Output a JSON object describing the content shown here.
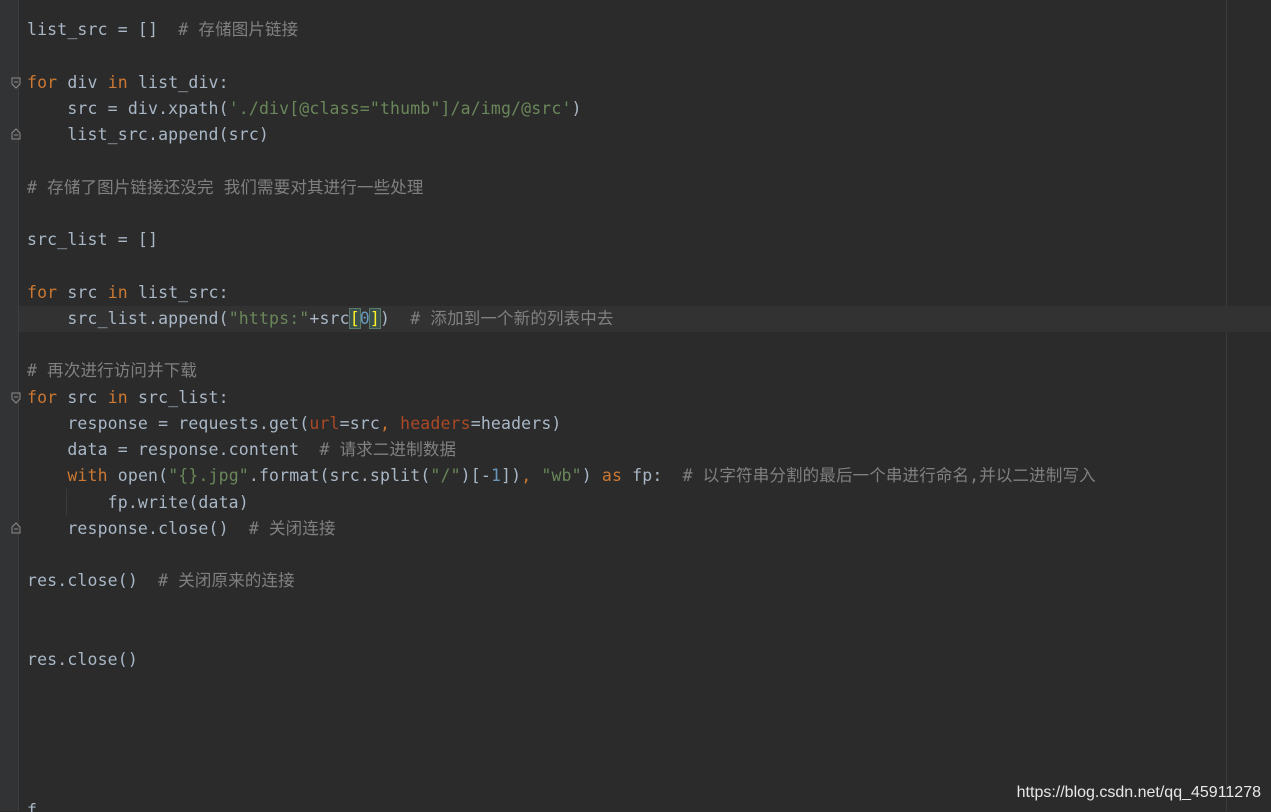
{
  "editor": {
    "lines": [
      {
        "id": "l1",
        "tokens": [
          {
            "t": "list_src = []  ",
            "c": ""
          },
          {
            "t": "# 存储图片链接",
            "c": "cmt"
          }
        ]
      },
      {
        "id": "l2",
        "tokens": [
          {
            "t": "for",
            "c": "kw"
          },
          {
            "t": " div ",
            "c": ""
          },
          {
            "t": "in",
            "c": "kw"
          },
          {
            "t": " list_div:",
            "c": ""
          }
        ]
      },
      {
        "id": "l3",
        "tokens": [
          {
            "t": "    src = div.xpath(",
            "c": ""
          },
          {
            "t": "'./div[@class=\"thumb\"]/a/img/@src'",
            "c": "str"
          },
          {
            "t": ")",
            "c": ""
          }
        ]
      },
      {
        "id": "l4",
        "tokens": [
          {
            "t": "    list_src.append(src)",
            "c": ""
          }
        ]
      },
      {
        "id": "l5",
        "tokens": [
          {
            "t": "# 存储了图片链接还没完 我们需要对其进行一些处理",
            "c": "cmt"
          }
        ]
      },
      {
        "id": "l6",
        "tokens": [
          {
            "t": "src_list = []",
            "c": ""
          }
        ]
      },
      {
        "id": "l7",
        "tokens": [
          {
            "t": "for",
            "c": "kw"
          },
          {
            "t": " src ",
            "c": ""
          },
          {
            "t": "in",
            "c": "kw"
          },
          {
            "t": " list_src:",
            "c": ""
          }
        ]
      },
      {
        "id": "l8",
        "tokens": [
          {
            "t": "    src_list.append(",
            "c": ""
          },
          {
            "t": "\"https:\"",
            "c": "str"
          },
          {
            "t": "+src",
            "c": ""
          },
          {
            "t": "[",
            "c": "brace-hl brace-y"
          },
          {
            "t": "0",
            "c": "num"
          },
          {
            "t": "]",
            "c": "brace-hl brace-y"
          },
          {
            "t": ")  ",
            "c": ""
          },
          {
            "t": "# 添加到一个新的列表中去",
            "c": "cmt"
          }
        ]
      },
      {
        "id": "l9",
        "tokens": [
          {
            "t": "# 再次进行访问并下载",
            "c": "cmt"
          }
        ]
      },
      {
        "id": "l10",
        "tokens": [
          {
            "t": "for",
            "c": "kw"
          },
          {
            "t": " src ",
            "c": ""
          },
          {
            "t": "in",
            "c": "kw"
          },
          {
            "t": " src_list:",
            "c": ""
          }
        ]
      },
      {
        "id": "l11",
        "tokens": [
          {
            "t": "    response = requests.get(",
            "c": ""
          },
          {
            "t": "url",
            "c": "param"
          },
          {
            "t": "=src",
            "c": ""
          },
          {
            "t": ", ",
            "c": "kw"
          },
          {
            "t": "headers",
            "c": "param"
          },
          {
            "t": "=headers)",
            "c": ""
          }
        ]
      },
      {
        "id": "l12",
        "tokens": [
          {
            "t": "    data = response.content  ",
            "c": ""
          },
          {
            "t": "# 请求二进制数据",
            "c": "cmt"
          }
        ]
      },
      {
        "id": "l13",
        "tokens": [
          {
            "t": "    ",
            "c": ""
          },
          {
            "t": "with",
            "c": "kw"
          },
          {
            "t": " ",
            "c": ""
          },
          {
            "t": "open",
            "c": "builtin"
          },
          {
            "t": "(",
            "c": ""
          },
          {
            "t": "\"{}.jpg\"",
            "c": "str"
          },
          {
            "t": ".format(src.split(",
            "c": ""
          },
          {
            "t": "\"/\"",
            "c": "str"
          },
          {
            "t": ")[-",
            "c": ""
          },
          {
            "t": "1",
            "c": "num"
          },
          {
            "t": "])",
            "c": ""
          },
          {
            "t": ", ",
            "c": "kw"
          },
          {
            "t": "\"wb\"",
            "c": "str"
          },
          {
            "t": ") ",
            "c": ""
          },
          {
            "t": "as",
            "c": "kw"
          },
          {
            "t": " fp:  ",
            "c": ""
          },
          {
            "t": "# 以字符串分割的最后一个串进行命名,并以二进制写入",
            "c": "cmt"
          }
        ]
      },
      {
        "id": "l14",
        "tokens": [
          {
            "t": "        fp.write(data)",
            "c": ""
          }
        ]
      },
      {
        "id": "l15",
        "tokens": [
          {
            "t": "    response.close()  ",
            "c": ""
          },
          {
            "t": "# 关闭连接",
            "c": "cmt"
          }
        ]
      },
      {
        "id": "l16",
        "tokens": [
          {
            "t": "res.close()  ",
            "c": ""
          },
          {
            "t": "# 关闭原来的连接",
            "c": "cmt"
          }
        ]
      },
      {
        "id": "l17",
        "tokens": [
          {
            "t": "res.close()",
            "c": ""
          }
        ]
      }
    ],
    "bottom_partial": "f  ",
    "watermark": "https://blog.csdn.net/qq_45911278"
  },
  "colors": {
    "background": "#2b2b2b",
    "keyword": "#cc7832",
    "string": "#6a8759",
    "comment": "#808080",
    "number": "#6897bb",
    "parameter": "#aa4926",
    "default": "#a9b7c6"
  }
}
